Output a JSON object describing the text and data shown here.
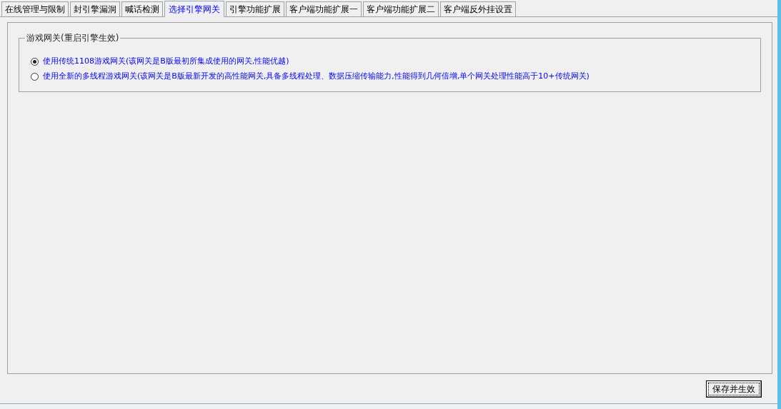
{
  "tabs": [
    {
      "label": "在线管理与限制",
      "selected": false
    },
    {
      "label": "封引擎漏洞",
      "selected": false
    },
    {
      "label": "喊话检测",
      "selected": false
    },
    {
      "label": "选择引擎网关",
      "selected": true
    },
    {
      "label": "引擎功能扩展",
      "selected": false
    },
    {
      "label": "客户端功能扩展一",
      "selected": false
    },
    {
      "label": "客户端功能扩展二",
      "selected": false
    },
    {
      "label": "客户端反外挂设置",
      "selected": false
    }
  ],
  "group": {
    "title": "游戏网关(重启引擎生效)",
    "options": [
      {
        "label": "使用传统1108游戏网关(该网关是B版最初所集成使用的网关,性能优越)",
        "selected": true
      },
      {
        "label": "使用全新的多线程游戏网关(该网关是B版最新开发的高性能网关,具备多线程处理、数据压缩传输能力,性能得到几何倍增,单个网关处理性能高于10+传统网关)",
        "selected": false
      }
    ]
  },
  "save_button": {
    "label": "保存并生效"
  }
}
